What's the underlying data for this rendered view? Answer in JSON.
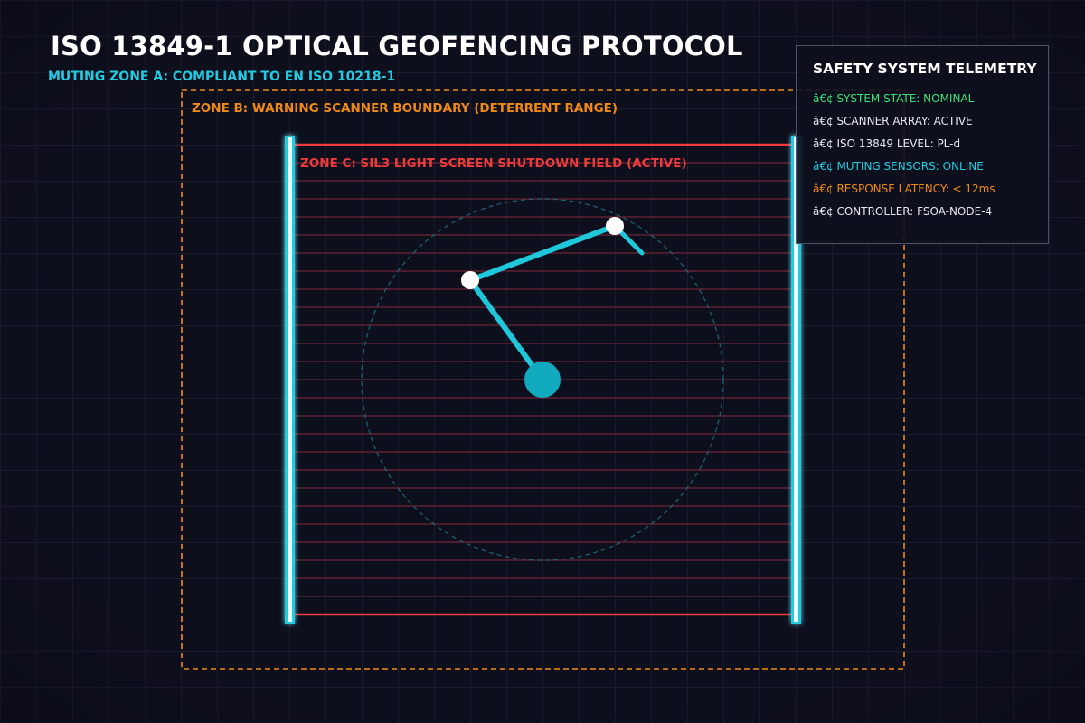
{
  "header": {
    "title": "ISO 13849-1 OPTICAL GEOFENCING PROTOCOL",
    "subtitle": "MUTING ZONE A: COMPLIANT TO EN ISO 10218-1"
  },
  "zones": {
    "zone_b_label": "ZONE B: WARNING SCANNER BOUNDARY (DETERRENT RANGE)",
    "zone_c_label": "ZONE C: SIL3 LIGHT SCREEN SHUTDOWN FIELD (ACTIVE)"
  },
  "telemetry": {
    "title": "SAFETY SYSTEM TELEMETRY",
    "lines": [
      {
        "text": "â€¢ SYSTEM STATE: NOMINAL",
        "color": "#3fe07a"
      },
      {
        "text": "â€¢ SCANNER ARRAY: ACTIVE",
        "color": "#e6e8ef"
      },
      {
        "text": "â€¢ ISO 13849 LEVEL: PL-d",
        "color": "#e6e8ef"
      },
      {
        "text": "â€¢ MUTING SENSORS: ONLINE",
        "color": "#22cbe0"
      },
      {
        "text": "â€¢ RESPONSE LATENCY: < 12ms",
        "color": "#f08a17"
      },
      {
        "text": "â€¢ CONTROLLER: FSOA-NODE-4",
        "color": "#e6e8ef"
      }
    ]
  },
  "colors": {
    "background": "#0e0f1d",
    "grid": "#262a3c",
    "muting_cyan": "#22cbe0",
    "warning_orange": "#f08a17",
    "shutdown_red": "#ee3b3b",
    "beam_red": "#6e2436",
    "robot_arm": "#1ec8da",
    "robot_base": "#10a9bd",
    "joint": "#ffffff"
  }
}
